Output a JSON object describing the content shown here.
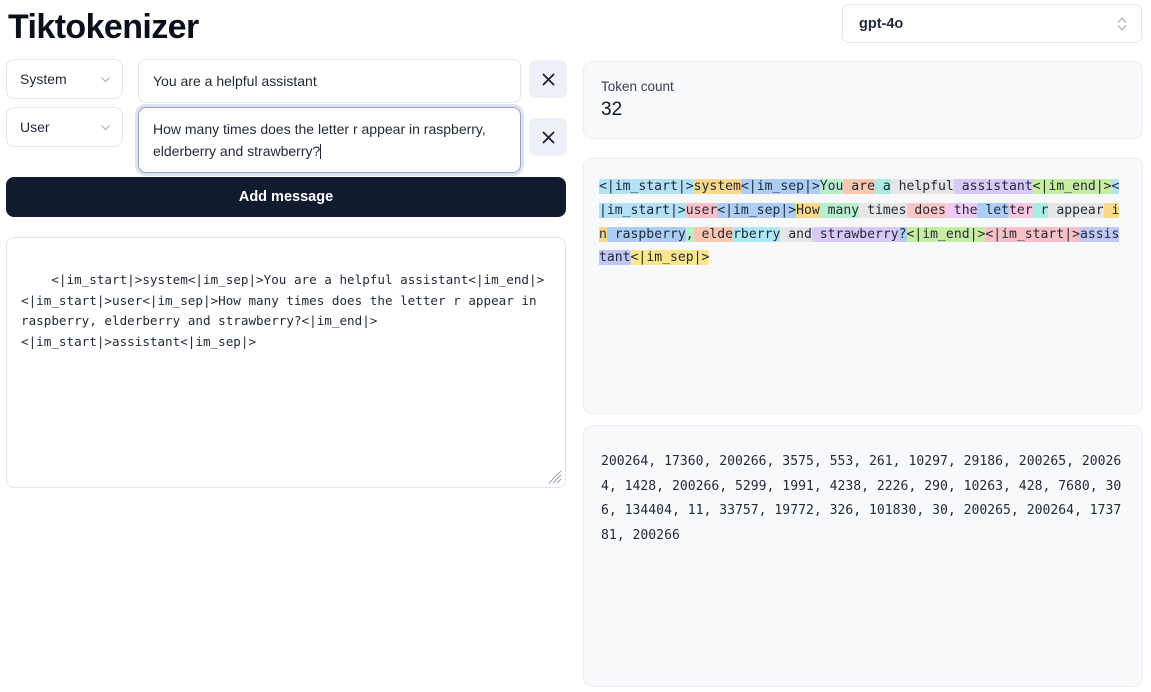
{
  "app": {
    "title": "Tiktokenizer"
  },
  "model_selector": {
    "value": "gpt-4o",
    "icon": "up-down-chevron-icon"
  },
  "messages": [
    {
      "role": "System",
      "role_icon": "chevron-down-icon",
      "content": "You are a helpful assistant",
      "remove_icon": "close-icon",
      "focused": false
    },
    {
      "role": "User",
      "role_icon": "chevron-down-icon",
      "content": "How many times does the letter r appear in raspberry, elderberry and strawberry?",
      "remove_icon": "close-icon",
      "focused": true
    }
  ],
  "add_message_button": "Add message",
  "prompt_textarea": {
    "value": "<|im_start|>system<|im_sep|>You are a helpful assistant<|im_end|>\n<|im_start|>user<|im_sep|>How many times does the letter r appear in raspberry, elderberry and strawberry?<|im_end|>\n<|im_start|>assistant<|im_sep|>",
    "resize_handle": "resize-grip-icon"
  },
  "token_count": {
    "label": "Token count",
    "value": "32"
  },
  "tokenized": {
    "tokens": [
      {
        "text": "<|im_start|>",
        "color": "#b5e1f5"
      },
      {
        "text": "system",
        "color": "#fcd98a"
      },
      {
        "text": "<|im_sep|>",
        "color": "#aecdf5"
      },
      {
        "text": "You",
        "color": "#b9efcd"
      },
      {
        "text": " are",
        "color": "#fbc7b0"
      },
      {
        "text": " a",
        "color": "#a9ece2"
      },
      {
        "text": " helpful",
        "color": "#e6e6e6"
      },
      {
        "text": " assistant",
        "color": "#d9c9f7"
      },
      {
        "text": "<|im_end|>",
        "color": "#c6eda0"
      },
      {
        "text": "<|im_start|>",
        "color": "#b5e1f5"
      },
      {
        "text": "user",
        "color": "#f9c0c6"
      },
      {
        "text": "<|im_sep|>",
        "color": "#aecdf5"
      },
      {
        "text": "How",
        "color": "#fcd98a"
      },
      {
        "text": " many",
        "color": "#b9efcd"
      },
      {
        "text": " times",
        "color": "#e6e6e6"
      },
      {
        "text": " does",
        "color": "#fbc7c7"
      },
      {
        "text": " the",
        "color": "#f0ccf5"
      },
      {
        "text": " let",
        "color": "#aecdf5"
      },
      {
        "text": "ter",
        "color": "#f9c7de"
      },
      {
        "text": " r",
        "color": "#a9ece2"
      },
      {
        "text": " appear",
        "color": "#e6e6e6"
      },
      {
        "text": " in",
        "color": "#fcd98a"
      },
      {
        "text": " raspberry",
        "color": "#aecdf5"
      },
      {
        "text": ",",
        "color": "#b9efcd"
      },
      {
        "text": " elde",
        "color": "#fbc7b0"
      },
      {
        "text": "rberry",
        "color": "#aee8f5"
      },
      {
        "text": " and",
        "color": "#e6e6e6"
      },
      {
        "text": " strawberry",
        "color": "#d9c9f7"
      },
      {
        "text": "?",
        "color": "#aecdf5"
      },
      {
        "text": "<|im_end|>",
        "color": "#c6eda0"
      },
      {
        "text": "<|im_start|>",
        "color": "#f9c0c6"
      },
      {
        "text": "assistant",
        "color": "#c2c8f5"
      },
      {
        "text": "<|im_sep|>",
        "color": "#fce78a"
      }
    ]
  },
  "token_ids": {
    "value": "200264, 17360, 200266, 3575, 553, 261, 10297, 29186, 200265, 200264, 1428, 200266, 5299, 1991, 4238, 2226, 290, 10263, 428, 7680, 306, 134404, 11, 33757, 19772, 326, 101830, 30, 200265, 200264, 173781, 200266"
  }
}
